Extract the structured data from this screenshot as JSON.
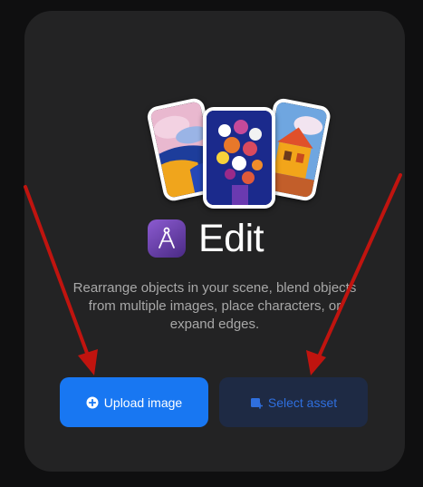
{
  "feature": {
    "title": "Edit",
    "description": "Rearrange objects in your scene, blend objects from multiple images, place characters, or expand edges.",
    "icon": "compass-icon"
  },
  "buttons": {
    "upload_label": "Upload image",
    "upload_icon": "plus-circle-icon",
    "select_label": "Select asset",
    "select_icon": "image-add-icon"
  },
  "colors": {
    "primary": "#1877f2",
    "secondary_bg": "#1e2a44",
    "secondary_text": "#2f6fde",
    "card_bg": "#232324",
    "arrow": "#c0140f"
  }
}
